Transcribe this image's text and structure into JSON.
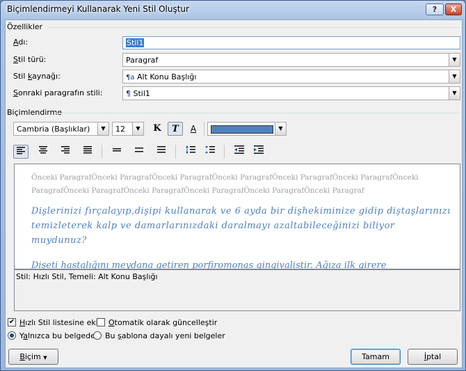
{
  "window": {
    "title": "Biçimlendirmeyi Kullanarak Yeni Stil Oluştur",
    "help_btn": "?",
    "close_btn": "X"
  },
  "properties": {
    "heading": "Özellikler",
    "name": {
      "label_u": "A",
      "label_rest": "dı:",
      "value": "Stil1"
    },
    "type": {
      "label_u": "S",
      "label_rest": "til türü:",
      "value": "Paragraf"
    },
    "based_on": {
      "label_pre": "Stil ",
      "label_u": "k",
      "label_rest": "aynağı:",
      "icon": "¶a",
      "value": "Alt Konu Başlığı"
    },
    "next": {
      "label_u": "S",
      "label_rest": "onraki paragrafın stili:",
      "icon": "¶",
      "value": "Stil1"
    }
  },
  "formatting": {
    "heading": "Biçimlendirme",
    "font": "Cambria (Başlıklar)",
    "size": "12",
    "bold": "K",
    "italic": "T",
    "underline": "A",
    "font_color": "#4f81bd"
  },
  "preview": {
    "previous_text": "Önceki ParagrafÖnceki ParagrafÖnceki ParagrafÖnceki ParagrafÖnceki ParagrafÖnceki ParagrafÖnceki ParagrafÖnceki ParagrafÖnceki ParagrafÖnceki ParagrafÖnceki ParagrafÖnceki Paragraf",
    "main_text": "Dişlerinizi fırçalayıp,dişipi kullanarak ve 6 ayda bir dişhekiminize gidip diştaşlarınızı temizleterek kalp ve damarlarınızdaki daralmayı azaltabileceğinizi biliyor muydunuz?",
    "next_text": "Dişeti hastalığını meydana getiren porfiromonas gingivalistir. Ağıza ilk girere"
  },
  "description": "Stil: Hızlı Stil, Temeli: Alt Konu Başlığı",
  "options": {
    "quick_style": {
      "label_u": "H",
      "label_rest": "ızlı Stil listesine ekle",
      "checked": true
    },
    "auto_update": {
      "label_u": "O",
      "label_rest": "tomatik olarak güncelleştir",
      "checked": false
    },
    "only_doc": {
      "label_pre": "Y",
      "label_u": "a",
      "label_rest": "lnızca bu belgede",
      "selected": true
    },
    "template": {
      "label_pre": "Bu ",
      "label_u": "ş",
      "label_rest": "ablona dayalı yeni belgeler",
      "selected": false
    }
  },
  "buttons": {
    "format": {
      "label_u": "B",
      "label_rest": "içim",
      "arrow": "▼"
    },
    "ok": "Tamam",
    "cancel": {
      "label_u": "İ",
      "label_rest": "ptal"
    }
  }
}
